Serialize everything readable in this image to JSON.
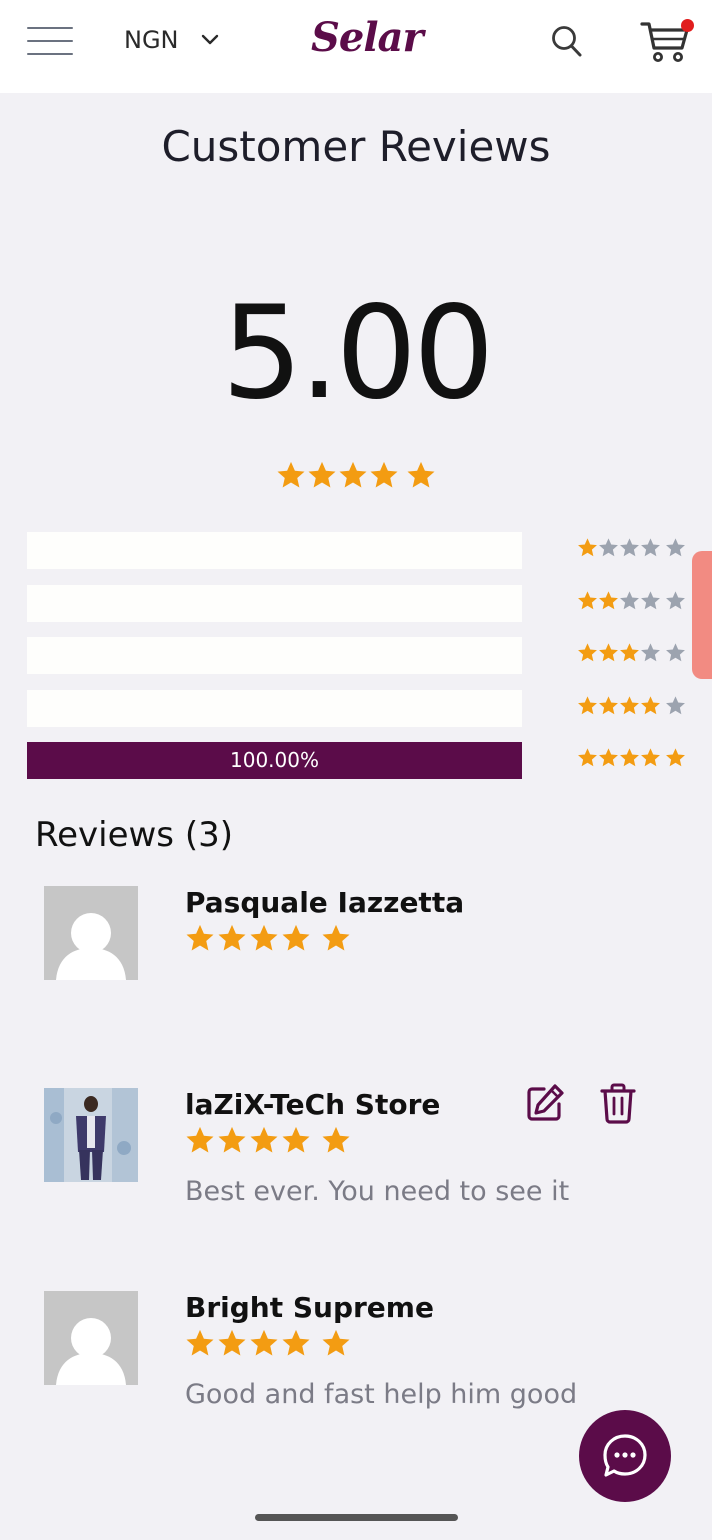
{
  "header": {
    "currency": "NGN",
    "logo_text": "Selar",
    "cart_badge_color": "#e11d1d",
    "icons": [
      "menu-icon",
      "chevron-down-icon",
      "search-icon",
      "cart-icon"
    ]
  },
  "page_title": "Customer Reviews",
  "rating": {
    "score": "5.00",
    "stars": 5
  },
  "distribution": [
    {
      "stars": 1,
      "fraction": 0.0,
      "label": ""
    },
    {
      "stars": 2,
      "fraction": 0.0,
      "label": ""
    },
    {
      "stars": 3,
      "fraction": 0.0,
      "label": ""
    },
    {
      "stars": 4,
      "fraction": 0.0,
      "label": ""
    },
    {
      "stars": 5,
      "fraction": 1.0,
      "label": "100.00%"
    }
  ],
  "reviews": {
    "heading": "Reviews (3)",
    "items": [
      {
        "name": "Pasquale Iazzetta",
        "stars": 5,
        "text": "",
        "avatar": "default",
        "editable": false
      },
      {
        "name": "laZiX-TeCh Store",
        "stars": 5,
        "text": "Best ever. You need to see it",
        "avatar": "photo",
        "editable": true
      },
      {
        "name": "Bright Supreme",
        "stars": 5,
        "text": "Good and fast help him good",
        "avatar": "default",
        "editable": false
      }
    ]
  },
  "colors": {
    "brand": "#5b0c49",
    "star": "#f39c12",
    "star_off": "#9ca3af",
    "scroll_handle": "#f28b82"
  }
}
